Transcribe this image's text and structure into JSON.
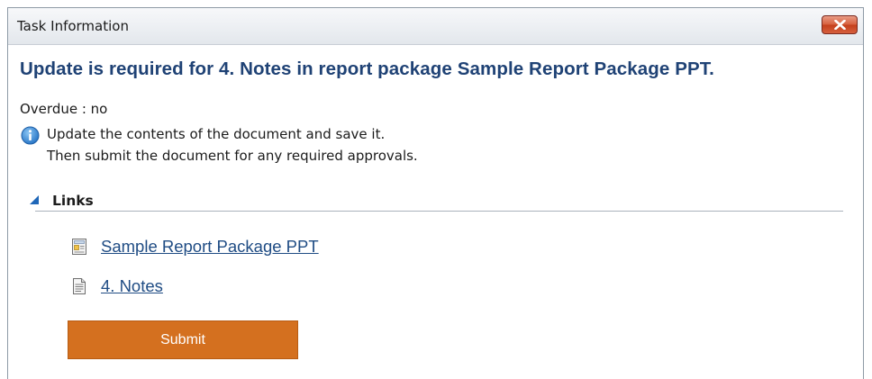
{
  "window": {
    "title": "Task Information",
    "close_icon": "close-icon"
  },
  "task": {
    "heading": "Update is required for 4. Notes in report package Sample Report Package PPT.",
    "overdue": "Overdue : no",
    "info_icon": "info-icon",
    "info_line1": "Update the contents of the document and save it.",
    "info_line2": "Then submit the document for any required approvals."
  },
  "links": {
    "title": "Links",
    "toggle_icon": "collapse-triangle-icon",
    "items": [
      {
        "label": "Sample Report Package PPT",
        "icon": "report-package-icon"
      },
      {
        "label": "4. Notes",
        "icon": "document-icon"
      }
    ]
  },
  "actions": {
    "submit_label": "Submit"
  },
  "colors": {
    "heading": "#1f4275",
    "link": "#1f4c84",
    "submit_bg": "#d4701f",
    "close_bg": "#c4401c"
  }
}
